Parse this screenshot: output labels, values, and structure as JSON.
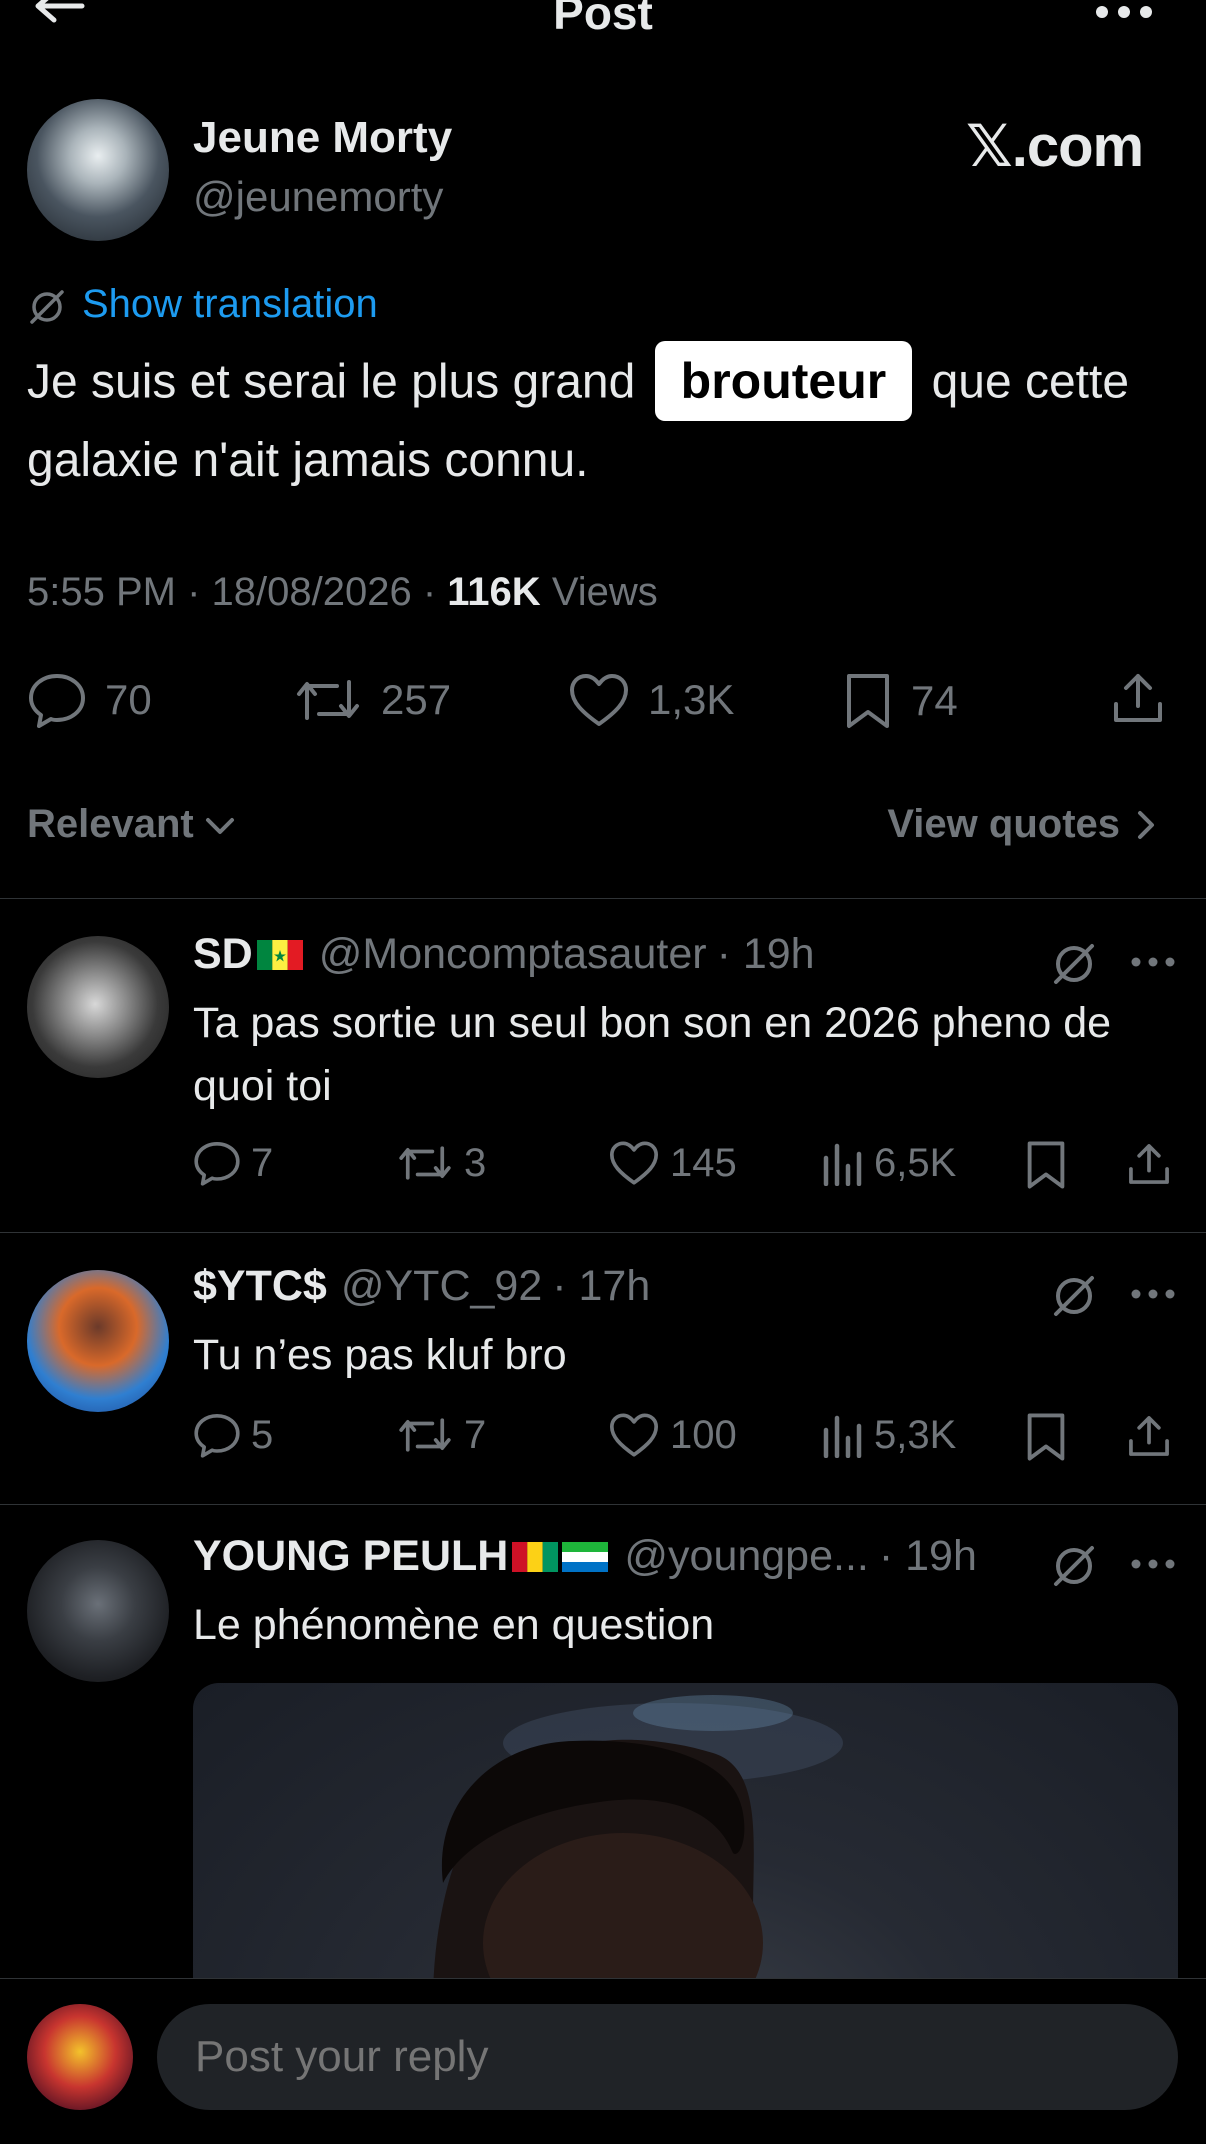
{
  "header": {
    "title": "Post",
    "back_icon": "arrow-left-icon",
    "more_icon": "more-horizontal-icon"
  },
  "post": {
    "author_name": "Jeune Morty",
    "author_handle": "@jeunemorty",
    "source_label_x": "𝕏",
    "source_label_rest": ".com",
    "translate_label": "Show translation",
    "text_before": "Je suis et serai le plus grand",
    "text_highlight": "brouteur",
    "text_after": "que cette galaxie n'ait jamais connu.",
    "time": "5:55 PM",
    "date": "18/08/2026",
    "views_count": "116K",
    "views_label": "Views",
    "replies": "70",
    "reposts": "257",
    "likes": "1,3K",
    "bookmarks": "74"
  },
  "sort": {
    "label": "Relevant",
    "view_quotes": "View quotes"
  },
  "replies": [
    {
      "name": "SD",
      "flag": "senegal",
      "handle": "@Moncomptasauter",
      "time": "· 19h",
      "text": "Ta pas sortie un seul bon son en 2026 pheno de quoi toi",
      "replies": "7",
      "reposts": "3",
      "likes": "145",
      "views": "6,5K"
    },
    {
      "name": "$YTC$",
      "handle": "@YTC_92",
      "time": "· 17h",
      "text": "Tu n’es pas kluf bro",
      "replies": "5",
      "reposts": "7",
      "likes": "100",
      "views": "5,3K"
    },
    {
      "name": "YOUNG PEULH",
      "flags": [
        "guinea",
        "sierra-leone"
      ],
      "handle": "@youngpe...",
      "time": "· 19h",
      "text": "Le phénomène en question"
    }
  ],
  "composer": {
    "placeholder": "Post your reply"
  },
  "colors": {
    "background": "#000000",
    "text": "#e7e9ea",
    "muted": "#71767b",
    "link": "#1d9bf0",
    "divider": "#2f3336",
    "input_bg": "#202327"
  }
}
